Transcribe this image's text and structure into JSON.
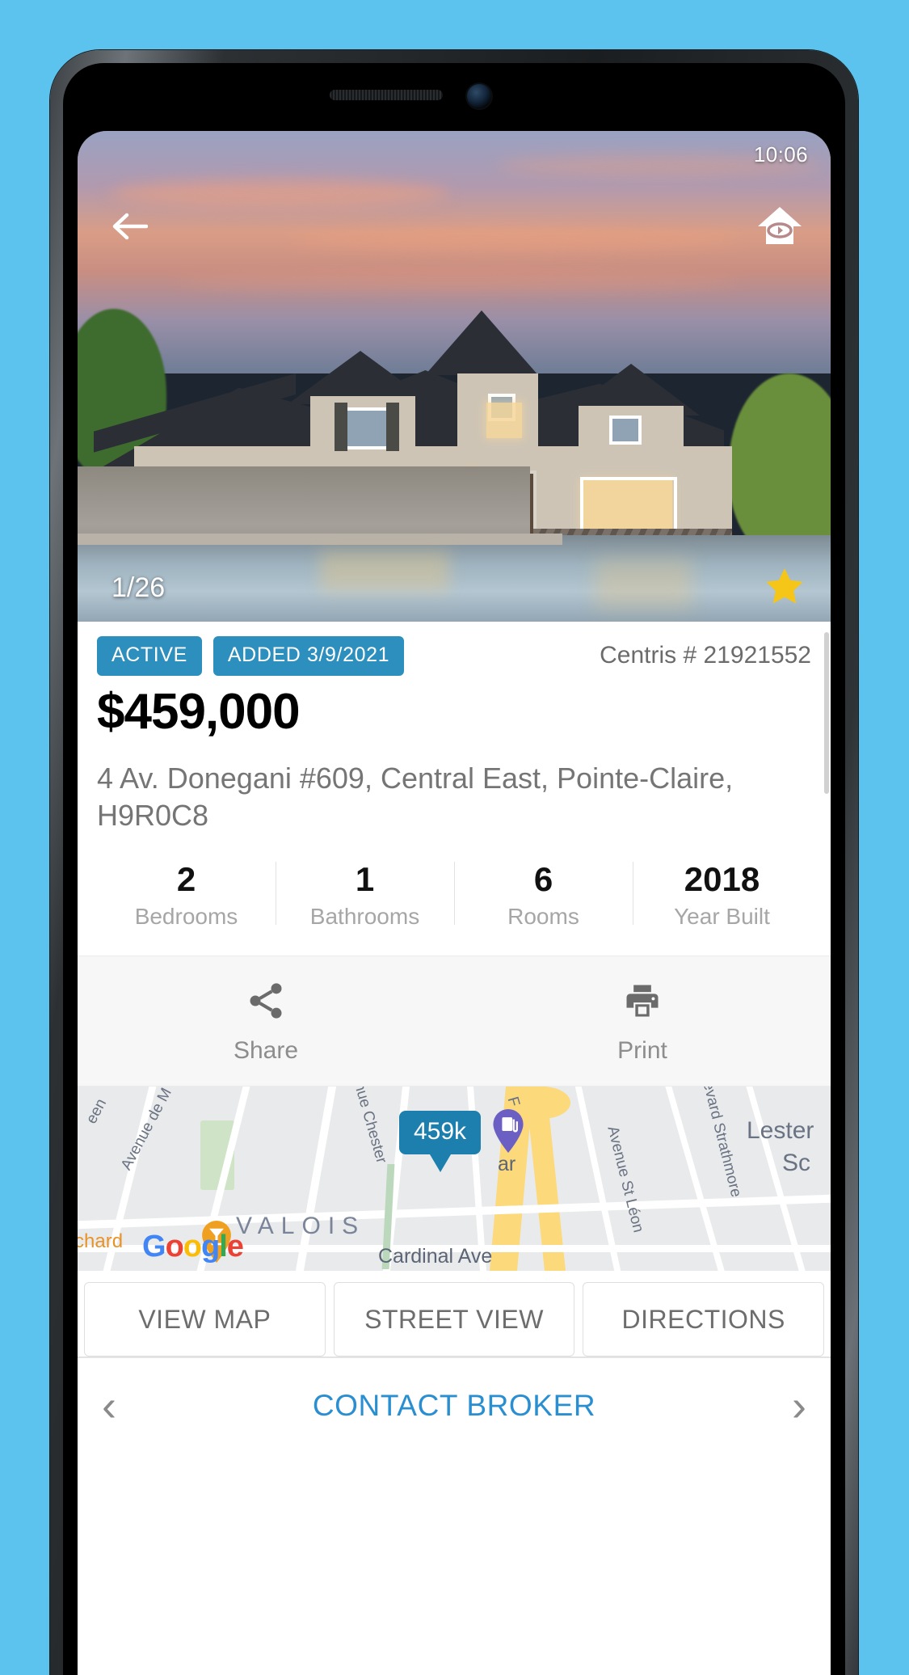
{
  "status_bar": {
    "time": "10:06"
  },
  "gallery": {
    "back_icon": "back-arrow-icon",
    "tour_icon": "house-360-tour-icon",
    "counter": "1/26",
    "favorite_icon": "star-icon"
  },
  "listing": {
    "badges": [
      "ACTIVE",
      "ADDED 3/9/2021"
    ],
    "centris": "Centris # 21921552",
    "price": "$459,000",
    "address": "4 Av. Donegani #609, Central East, Pointe-Claire, H9R0C8",
    "stats": [
      {
        "value": "2",
        "label": "Bedrooms"
      },
      {
        "value": "1",
        "label": "Bathrooms"
      },
      {
        "value": "6",
        "label": "Rooms"
      },
      {
        "value": "2018",
        "label": "Year Built"
      }
    ]
  },
  "actions": [
    {
      "label": "Share",
      "icon": "share-icon"
    },
    {
      "label": "Print",
      "icon": "print-icon"
    }
  ],
  "map": {
    "price_pin": "459k",
    "neighborhood": "VALOIS",
    "attribution": "Google",
    "labels": [
      "Avenue de M",
      "een",
      "nue Chester",
      "F",
      "ar",
      "Boulevard Strathmore",
      "Avenue St Léon",
      "Lester",
      "Sc",
      "Cardinal Ave",
      "chard"
    ],
    "buttons": [
      "VIEW MAP",
      "STREET VIEW",
      "DIRECTIONS"
    ]
  },
  "contact": {
    "prev_icon": "chevron-left-icon",
    "label": "CONTACT BROKER",
    "next_icon": "chevron-right-icon"
  },
  "colors": {
    "accent_blue": "#2d8fbe",
    "link_blue": "#2a8fd0",
    "star_yellow": "#f5c518",
    "page_bg": "#5cc3ee"
  }
}
